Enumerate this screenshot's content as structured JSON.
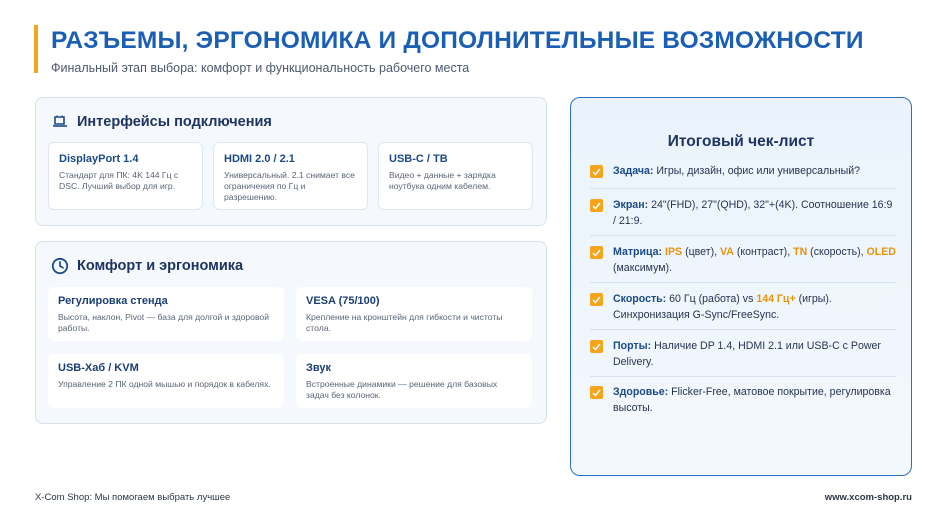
{
  "header": {
    "title": "РАЗЪЕМЫ, ЭРГОНОМИКА И ДОПОЛНИТЕЛЬНЫЕ ВОЗМОЖНОСТИ",
    "subtitle": "Финальный этап выбора: комфорт и функциональность рабочего места"
  },
  "interfaces": {
    "icon": "plug-icon",
    "title": "Интерфейсы подключения",
    "cards": [
      {
        "title": "DisplayPort 1.4",
        "desc": "Стандарт для ПК: 4K 144 Гц с DSC. Лучший выбор для игр."
      },
      {
        "title": "HDMI 2.0 / 2.1",
        "desc": "Универсальный. 2.1 снимает все ограничения по Гц и разрешению."
      },
      {
        "title": "USB-C / TB",
        "desc": "Видео + данные + зарядка ноутбука одним кабелем."
      }
    ]
  },
  "comfort": {
    "icon": "clock-icon",
    "title": "Комфорт и эргономика",
    "cards": [
      {
        "title": "Регулировка стенда",
        "desc": "Высота, наклон, Pivot — база для долгой и здоровой работы."
      },
      {
        "title": "VESA (75/100)",
        "desc": "Крепление на кронштейн для гибкости и чистоты стола."
      },
      {
        "title": "USB-Хаб / KVM",
        "desc": "Управление 2 ПК одной мышью и порядок в кабелях."
      },
      {
        "title": "Звук",
        "desc": "Встроенные динамики — решение для базовых задач без колонок."
      }
    ]
  },
  "checklist": {
    "title": "Итоговый чек-лист",
    "items": [
      {
        "label": "Задача:",
        "t1": " Игры, дизайн, офис или универсальный?"
      },
      {
        "label": "Экран:",
        "t1": " 24\"(FHD), 27\"(QHD), 32\"+(4K). Соотношение 16:9 / 21:9."
      },
      {
        "label": "Матрица:",
        "h1": "IPS",
        "t1": " (цвет), ",
        "h2": "VA",
        "t2": " (контраст), ",
        "h3": "TN",
        "t3": " (скорость), ",
        "h4": "OLED",
        "t4": " (максимум)."
      },
      {
        "label": "Скорость:",
        "t1": " 60 Гц (работа) vs ",
        "h1": "144 Гц+",
        "t2": " (игры). Синхронизация G-Sync/FreeSync."
      },
      {
        "label": "Порты:",
        "t1": " Наличие DP 1.4, HDMI 2.1 или USB-C с Power Delivery."
      },
      {
        "label": "Здоровье:",
        "t1": " Flicker-Free, матовое покрытие, регулировка высоты."
      }
    ]
  },
  "footer": {
    "left": "X-Com Shop: Мы помогаем выбрать лучшее",
    "right": "www.xcom-shop.ru"
  },
  "colors": {
    "accent": "#f4a51c",
    "title_blue": "#1b5fb4",
    "checklist_border": "#2f6fc0"
  }
}
